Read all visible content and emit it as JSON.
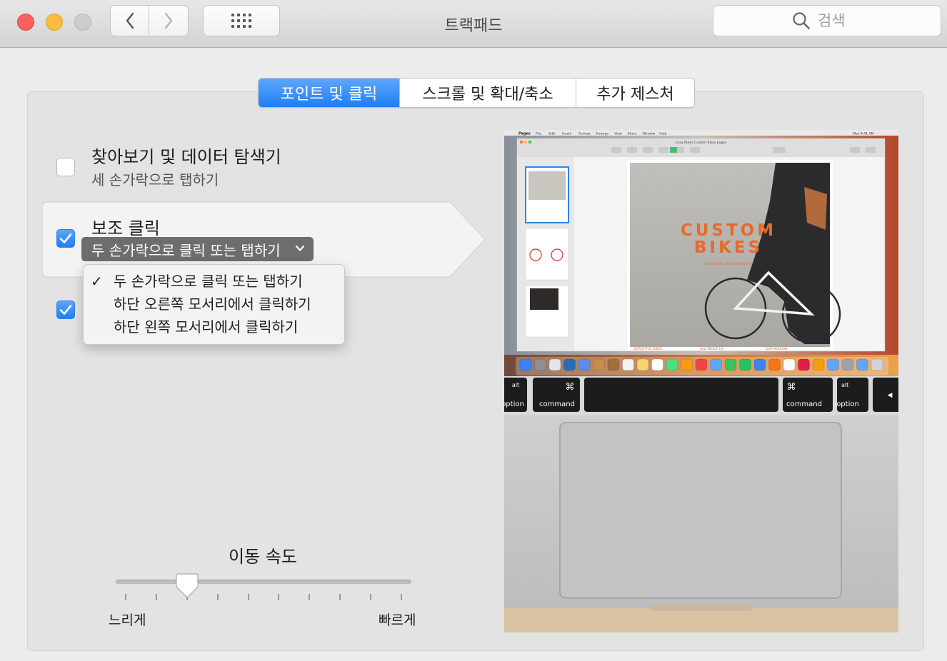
{
  "window": {
    "title": "트랙패드",
    "search_placeholder": "검색"
  },
  "toolbar": {
    "back_icon": "chevron-left-icon",
    "forward_icon": "chevron-right-icon",
    "grid_icon": "show-all-grid-icon",
    "search_icon": "magnifier-icon"
  },
  "tabs": [
    {
      "label": "포인트 및 클릭",
      "active": true
    },
    {
      "label": "스크롤 및 확대/축소",
      "active": false
    },
    {
      "label": "추가 제스처",
      "active": false
    }
  ],
  "options": {
    "lookup": {
      "title": "찾아보기 및 데이터 탐색기",
      "subtitle": "세 손가락으로 탭하기",
      "checked": false
    },
    "secondary_click": {
      "title": "보조 클릭",
      "selected": "두 손가락으로 클릭 또는 탭하기",
      "checked": true
    },
    "third_option": {
      "checked": true
    }
  },
  "dropdown_menu": {
    "items": [
      {
        "label": "두 손가락으로 클릭 또는 탭하기",
        "checked": true
      },
      {
        "label": "하단 오른쪽 모서리에서 클릭하기",
        "checked": false
      },
      {
        "label": "하단 왼쪽 모서리에서 클릭하기",
        "checked": false
      }
    ]
  },
  "tracking_speed": {
    "label": "이동 속도",
    "min_label": "느리게",
    "max_label": "빠르게",
    "value_step": 2,
    "step_count": 10
  },
  "preview": {
    "menubar_app": "Pages",
    "menubar_items": [
      "File",
      "Edit",
      "Insert",
      "Format",
      "Arrange",
      "View",
      "Share",
      "Window",
      "Help"
    ],
    "menubar_clock": "Mon 9:41 AM",
    "doc_title": "Easy Rides Custom Bikes.pages",
    "doc_heading_line1": "CUSTOM",
    "doc_heading_line2": "BIKES",
    "doc_tagline": "EASY RIDES, SAN FRANCISCO",
    "doc_footer": [
      "BEAUTIFUL BIKES.",
      "ALL ABOUT US",
      "OUR MISSION"
    ],
    "keys": {
      "alt": "alt",
      "option": "option",
      "command": "command",
      "cmd_symbol": "⌘",
      "arrow": "◀"
    }
  },
  "colors": {
    "accent": "#1d7ef5",
    "checkbox_checked": "#2f7fe3",
    "close": "#fc605c",
    "minimize": "#fdbc40",
    "doc_heading": "#e8692a"
  }
}
